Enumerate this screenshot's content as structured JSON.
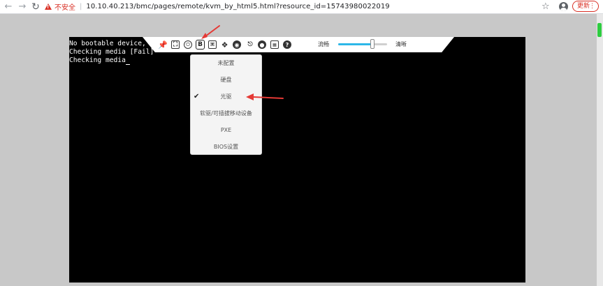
{
  "browser": {
    "back_icon": "back-arrow-icon",
    "forward_icon": "forward-arrow-icon",
    "reload_icon": "reload-icon",
    "security_label": "不安全",
    "url": "10.10.40.213/bmc/pages/remote/kvm_by_html5.html?resource_id=15743980022019",
    "update_label": "更新"
  },
  "console": {
    "lines": [
      "No bootable device, Sy",
      "Checking media [Fail]",
      "Checking media"
    ]
  },
  "toolbar": {
    "quality_low_label": "流畅",
    "quality_high_label": "清晰",
    "quality_level": 0.7
  },
  "boot_menu": {
    "items": [
      {
        "label": "未配置",
        "selected": false
      },
      {
        "label": "硬盘",
        "selected": false
      },
      {
        "label": "光驱",
        "selected": true
      },
      {
        "label": "软驱/可插拔移动设备",
        "selected": false
      },
      {
        "label": "PXE",
        "selected": false
      },
      {
        "label": "BIOS设置",
        "selected": false
      }
    ]
  },
  "colors": {
    "annotation_arrow": "#e53935",
    "slider_fill": "#2db7e8",
    "insecure": "#d93025"
  }
}
